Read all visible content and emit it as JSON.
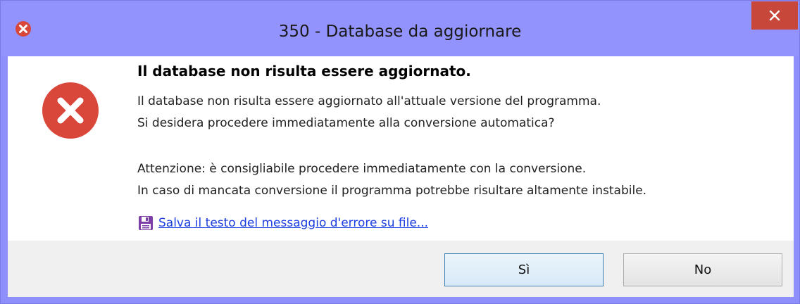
{
  "window": {
    "title": "350 - Database da aggiornare",
    "close_symbol": "✕",
    "accent_color": "#9393fd",
    "close_color": "#c7473a"
  },
  "message": {
    "heading": "Il database non risulta essere aggiornato.",
    "lines": [
      "Il database non risulta essere aggiornato all'attuale versione del programma.",
      "Si desidera procedere immediatamente alla conversione automatica?",
      "Attenzione: è consigliabile procedere immediatamente con la conversione.",
      "In caso di mancata conversione il programma potrebbe risultare altamente instabile."
    ],
    "icon": "error-icon",
    "icon_color": "#d9463a"
  },
  "save_link": {
    "icon": "floppy-disk-icon",
    "label": "Salva il testo del messaggio d'errore su file..."
  },
  "buttons": {
    "yes_label": "Sì",
    "no_label": "No"
  }
}
